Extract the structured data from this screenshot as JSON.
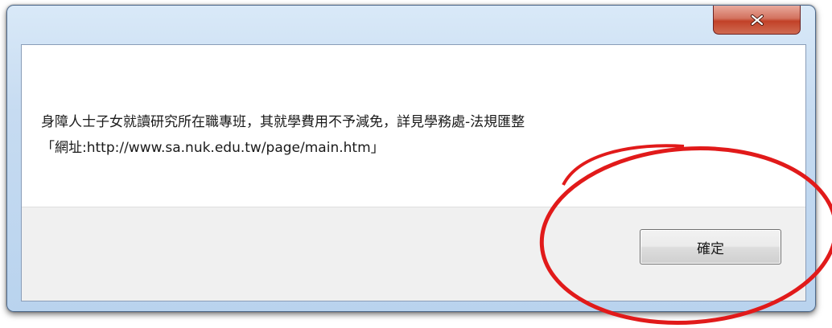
{
  "dialog": {
    "title": "",
    "close_icon": "close-x-icon",
    "message_lines": [
      "身障人士子女就讀研究所在職專班，其就學費用不予減免，詳見學務處-法規匯整",
      "「網址:http://www.sa.nuk.edu.tw/page/main.htm」"
    ],
    "ok_label": "確定"
  },
  "annotation": {
    "shape": "ellipse",
    "target": "ok-button",
    "color": "#e11a1a"
  },
  "colors": {
    "titlebar": "#c6dbf1",
    "close_button": "#c24128",
    "footer": "#f0f0f0"
  }
}
